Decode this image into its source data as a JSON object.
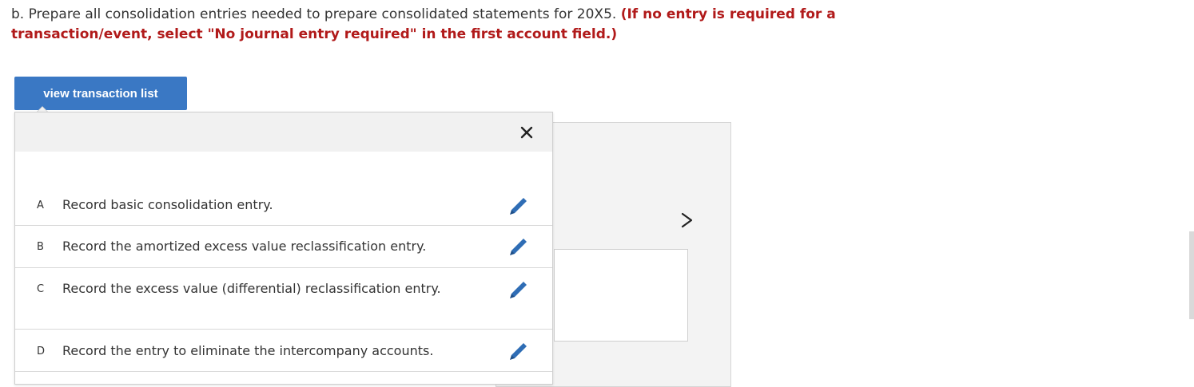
{
  "question": {
    "text": "b. Prepare all consolidation entries needed to prepare consolidated statements for 20X5.",
    "instruction": "(If no entry is required for a transaction/event, select \"No journal entry required\" in the first account field.)"
  },
  "view_button": {
    "label": "view transaction list"
  },
  "popup": {
    "close_icon": "close-icon",
    "transactions": [
      {
        "letter": "A",
        "text": "Record basic consolidation entry.",
        "icon": "pencil-edit-icon"
      },
      {
        "letter": "B",
        "text": "Record the amortized excess value reclassification entry.",
        "icon": "pencil-edit-icon"
      },
      {
        "letter": "C",
        "text": "Record the excess value (differential) reclassification entry.",
        "icon": "pencil-edit-icon"
      },
      {
        "letter": "D",
        "text": "Record the entry to eliminate the intercompany accounts.",
        "icon": "pencil-edit-icon"
      }
    ]
  },
  "colors": {
    "accent_button": "#3a78c4",
    "instruction_red": "#b11a1a",
    "edit_icon_blue": "#2f6db5"
  },
  "icons": {
    "next": "chevron-right-icon"
  }
}
